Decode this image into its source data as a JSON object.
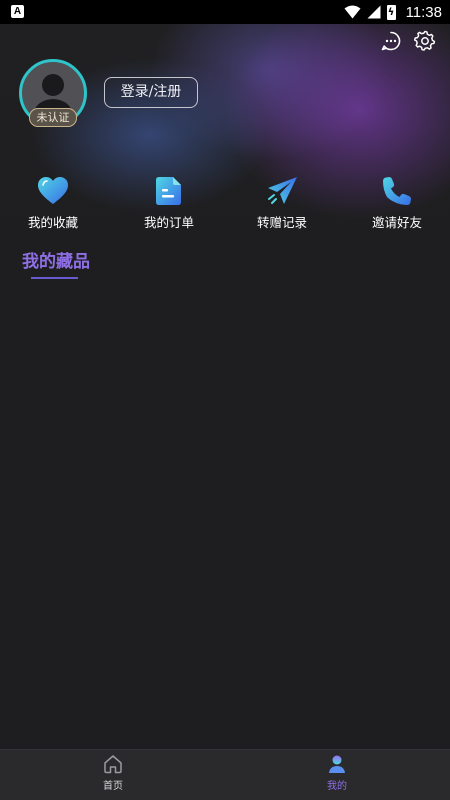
{
  "status_bar": {
    "notification_glyph": "A",
    "time": "11:38",
    "battery_glyph": "ϟ"
  },
  "header": {
    "icons": [
      "chat-bubble-icon",
      "gear-icon"
    ]
  },
  "profile": {
    "badge": "未认证",
    "login_label": "登录/注册",
    "ring_color": "#2ec4c9"
  },
  "quick_actions": [
    {
      "label": "我的收藏",
      "icon": "heart-icon"
    },
    {
      "label": "我的订单",
      "icon": "document-icon"
    },
    {
      "label": "转赠记录",
      "icon": "paper-plane-icon"
    },
    {
      "label": "邀请好友",
      "icon": "phone-icon"
    }
  ],
  "collection": {
    "title": "我的藏品",
    "accent": "#8e6fe6"
  },
  "bottom_nav": {
    "items": [
      {
        "label": "首页",
        "icon": "home-icon",
        "active": false
      },
      {
        "label": "我的",
        "icon": "user-icon",
        "active": true
      }
    ],
    "active_color": "#8e6fe6"
  }
}
